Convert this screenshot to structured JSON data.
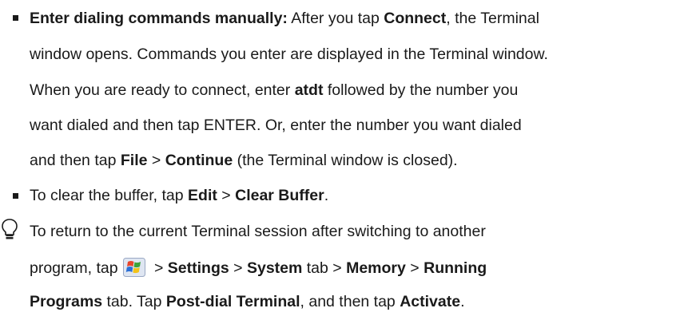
{
  "bullet1": {
    "line1": {
      "bold_lead": "Enter dialing commands manually:",
      "t1": " After you tap ",
      "b1": "Connect",
      "t2": ", the Terminal"
    },
    "line2": "window opens. Commands you enter are displayed in the Terminal window.",
    "line3": {
      "t1": "When you are ready to connect, enter ",
      "b1": "atdt",
      "t2": " followed by the number you"
    },
    "line4": "want dialed and then tap ENTER. Or, enter the number you want dialed",
    "line5": {
      "t1": "and then tap ",
      "b1": "File",
      "t2": " > ",
      "b2": "Continue",
      "t3": " (the Terminal window is closed)."
    }
  },
  "bullet2": {
    "t1": "To clear the buffer, tap ",
    "b1": "Edit",
    "t2": " > ",
    "b2": "Clear Buffer",
    "t3": "."
  },
  "tip": {
    "icon": "lightbulb-icon",
    "line1": "To return to the current Terminal session after switching to another",
    "line2": {
      "t1": "program, tap",
      "start_icon": "windows-start-icon",
      "t2": " > ",
      "b1": "Settings",
      "t3": " > ",
      "b2": "System",
      "t4": " tab > ",
      "b3": "Memory",
      "t5": " > ",
      "b4": "Running"
    },
    "line3": {
      "b1": "Programs",
      "t1": " tab. Tap ",
      "b2": "Post-dial Terminal",
      "t2": ", and then tap ",
      "b3": "Activate",
      "t3": "."
    }
  }
}
